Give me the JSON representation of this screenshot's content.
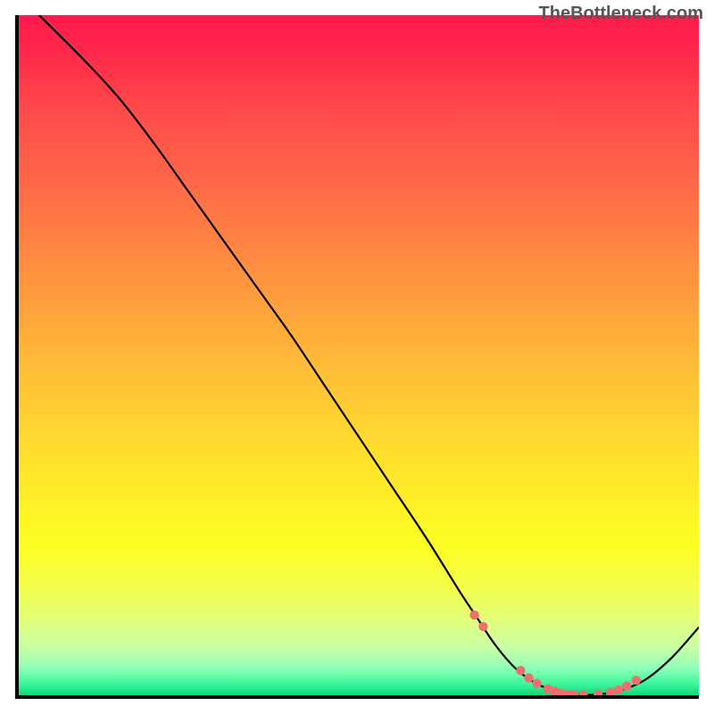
{
  "watermark": "TheBottleneck.com",
  "chart_data": {
    "type": "line",
    "title": "",
    "xlabel": "",
    "ylabel": "",
    "xlim": [
      0,
      100
    ],
    "ylim": [
      0,
      100
    ],
    "series": [
      {
        "name": "curve",
        "color": "#000000",
        "x": [
          3,
          10,
          15,
          20,
          25,
          30,
          35,
          40,
          45,
          50,
          55,
          60,
          65,
          67,
          70,
          73,
          76,
          79,
          82,
          85,
          88,
          92,
          96,
          100
        ],
        "y": [
          100,
          93,
          87.5,
          81,
          74,
          67,
          60,
          53,
          45.5,
          38,
          30.5,
          23,
          15,
          12,
          7.5,
          4,
          1.8,
          0.6,
          0.1,
          0.1,
          0.6,
          2.2,
          5.5,
          10
        ]
      }
    ],
    "markers": {
      "name": "highlight-dots",
      "color": "#ef6f6f",
      "x": [
        67.0,
        68.3,
        73.8,
        75.0,
        76.2,
        77.8,
        78.8,
        79.8,
        80.8,
        81.6,
        83.0,
        85.2,
        87.0,
        88.2,
        89.4,
        90.8
      ],
      "y": [
        11.8,
        10.1,
        3.65,
        2.55,
        1.75,
        0.95,
        0.6,
        0.28,
        0.12,
        0.08,
        0.05,
        0.1,
        0.45,
        0.8,
        1.35,
        2.2
      ]
    },
    "gradient_stops": [
      {
        "pos": 0.0,
        "color": "#ff1a4d"
      },
      {
        "pos": 0.14,
        "color": "#ff4a4a"
      },
      {
        "pos": 0.34,
        "color": "#ff8542"
      },
      {
        "pos": 0.54,
        "color": "#ffc336"
      },
      {
        "pos": 0.72,
        "color": "#fff126"
      },
      {
        "pos": 0.84,
        "color": "#f3ff49"
      },
      {
        "pos": 0.93,
        "color": "#c8ffa4"
      },
      {
        "pos": 0.985,
        "color": "#35f59a"
      },
      {
        "pos": 1.0,
        "color": "#14d47a"
      }
    ]
  }
}
